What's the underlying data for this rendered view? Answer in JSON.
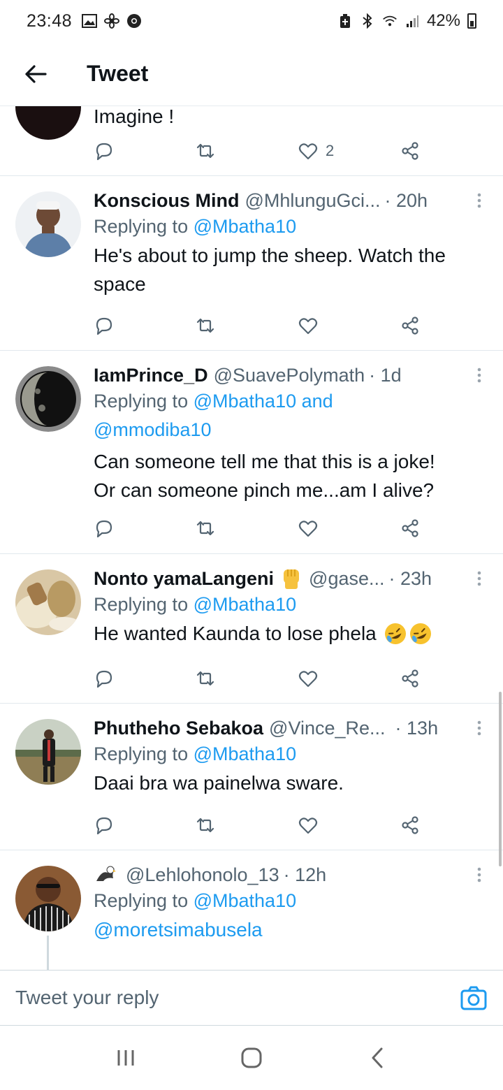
{
  "status_bar": {
    "time": "23:48",
    "battery": "42%"
  },
  "header": {
    "title": "Tweet"
  },
  "partial_tweet": {
    "text": "Imagine !",
    "likes": "2"
  },
  "tweets": [
    {
      "name": "Konscious Mind",
      "handle": "@MhlunguGci...",
      "time": "· 20h",
      "reply_prefix": "Replying to",
      "reply_to": "@Mbatha10",
      "reply_to_2": "",
      "lines": [
        "He's about to jump the sheep. Watch the",
        "space"
      ]
    },
    {
      "name": "IamPrince_D",
      "handle": "@SuavePolymath",
      "time": "· 1d",
      "reply_prefix": "Replying to",
      "reply_to": "@Mbatha10 and",
      "reply_to_2": "@mmodiba10",
      "lines": [
        "Can someone tell me that this is a joke!",
        "Or can someone pinch me...am I alive?"
      ]
    },
    {
      "name": "Nonto yamaLangeni",
      "handle": "@gase...",
      "time": "· 23h",
      "reply_prefix": "Replying to",
      "reply_to": "@Mbatha10",
      "reply_to_2": "",
      "lines": [
        "He wanted  Kaunda to lose phela"
      ]
    },
    {
      "name": "Phutheho Sebakoa",
      "handle": "@Vince_Re...",
      "time": "· 13h",
      "reply_prefix": "Replying to",
      "reply_to": "@Mbatha10",
      "reply_to_2": "",
      "lines": [
        "Daai bra wa painelwa sware."
      ]
    },
    {
      "name": "",
      "handle": "@Lehlohonolo_13",
      "time": "· 12h",
      "reply_prefix": "Replying to",
      "reply_to": "@Mbatha10",
      "reply_to_2": "",
      "lines": [
        "@moretsimabusela"
      ]
    }
  ],
  "reply_bar": {
    "placeholder": "Tweet your reply"
  },
  "icons": {
    "reply": "reply-icon",
    "retweet": "retweet-icon",
    "like": "heart-icon",
    "share": "share-icon",
    "more": "more-vertical-icon",
    "camera": "camera-icon"
  },
  "colors": {
    "link": "#1d9bf0",
    "secondary_text": "#536471",
    "divider": "#e1e8ed"
  }
}
